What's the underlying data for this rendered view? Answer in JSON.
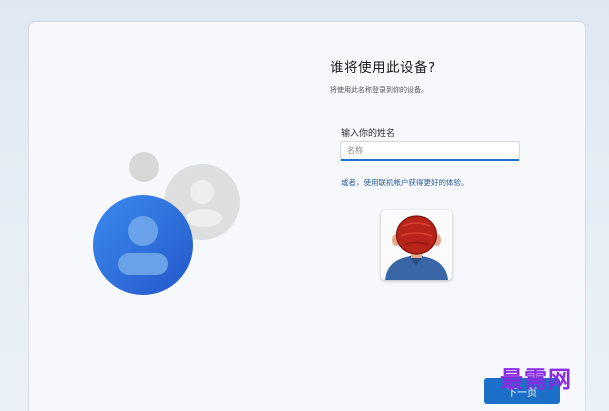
{
  "setup": {
    "title": "谁将使用此设备?",
    "subtitle": "将使用此名称登录到你的设备。",
    "name_label": "输入你的姓名",
    "name_placeholder": "名称",
    "name_value": "",
    "account_link": "或者，使用联机帐户获得更好的体验。",
    "next_button": "下一页"
  },
  "watermark": "最需网",
  "colors": {
    "accent": "#1b6fc6",
    "link": "#2a5f9e",
    "avatar_primary": "#2e70d9",
    "avatar_secondary": "#d9d9d9",
    "watermark": "#8a2be2"
  },
  "icons": {
    "main_avatar": "user-avatar-icon",
    "secondary_avatar": "user-avatar-icon",
    "photo": "profile-photo"
  }
}
